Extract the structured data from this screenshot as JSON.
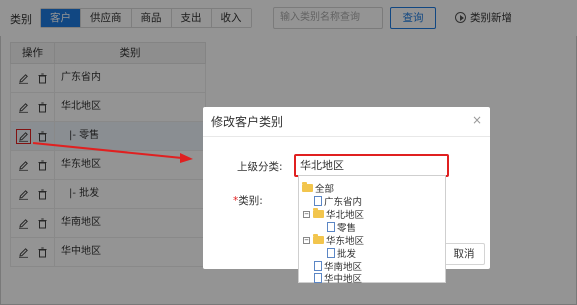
{
  "page_label": "类别",
  "tabs": [
    {
      "label": "客户",
      "active": true
    },
    {
      "label": "供应商",
      "active": false
    },
    {
      "label": "商品",
      "active": false
    },
    {
      "label": "支出",
      "active": false
    },
    {
      "label": "收入",
      "active": false
    }
  ],
  "search": {
    "placeholder": "输入类别名称查询"
  },
  "query_button": "查询",
  "add_button": "类别新增",
  "table": {
    "headers": {
      "op": "操作",
      "category": "类别"
    },
    "rows": [
      {
        "category": "广东省内"
      },
      {
        "category": "华北地区"
      },
      {
        "category": "|- 零售"
      },
      {
        "category": "华东地区"
      },
      {
        "category": "|- 批发"
      },
      {
        "category": "华南地区"
      },
      {
        "category": "华中地区"
      }
    ]
  },
  "modal": {
    "title": "修改客户类别",
    "close": "×",
    "parent_label": "上级分类:",
    "parent_value": "华北地区",
    "category_label_req": "*",
    "category_label": "类别:",
    "cancel": "取消"
  },
  "tree": {
    "nodes": [
      {
        "label": "全部",
        "icon": "folder-icon"
      },
      {
        "label": "广东省内",
        "icon": "doc-icon"
      },
      {
        "label": "华北地区",
        "icon": "folder-icon",
        "toggle": "−"
      },
      {
        "label": "零售",
        "icon": "doc-icon"
      },
      {
        "label": "华东地区",
        "icon": "folder-icon",
        "toggle": "−"
      },
      {
        "label": "批发",
        "icon": "doc-icon"
      },
      {
        "label": "华南地区",
        "icon": "doc-icon"
      },
      {
        "label": "华中地区",
        "icon": "doc-icon"
      }
    ]
  },
  "colors": {
    "accent": "#1e7be0",
    "highlight": "#e02020"
  }
}
